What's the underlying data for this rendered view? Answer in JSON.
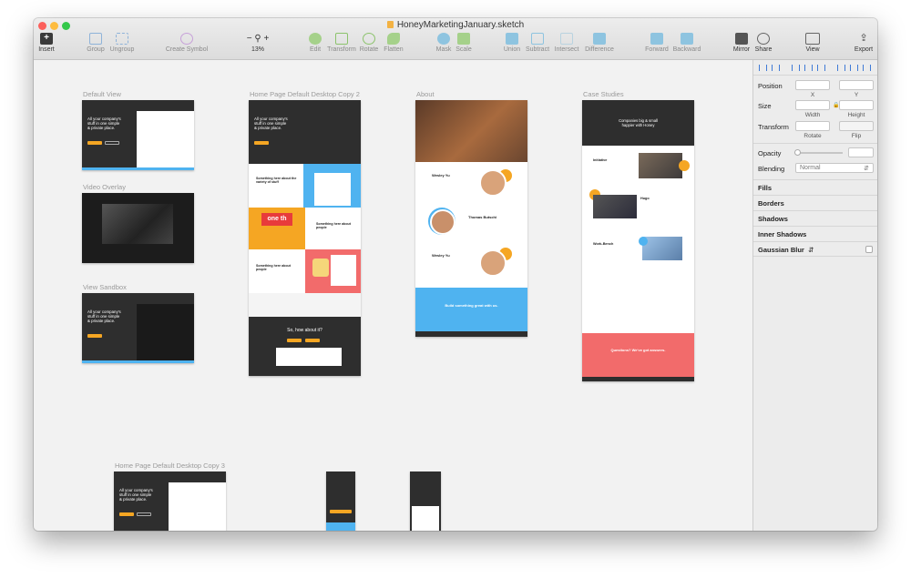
{
  "window": {
    "title": "HoneyMarketingJanuary.sketch"
  },
  "toolbar": {
    "insert": "Insert",
    "group": "Group",
    "ungroup": "Ungroup",
    "create_symbol": "Create Symbol",
    "zoom": "13%",
    "zoom_minus": "−",
    "zoom_plus": "+",
    "edit": "Edit",
    "transform": "Transform",
    "rotate": "Rotate",
    "flatten": "Flatten",
    "mask": "Mask",
    "scale": "Scale",
    "union": "Union",
    "subtract": "Subtract",
    "intersect": "Intersect",
    "difference": "Difference",
    "forward": "Forward",
    "backward": "Backward",
    "mirror": "Mirror",
    "share": "Share",
    "view": "View",
    "export": "Export"
  },
  "artboards": {
    "default_view": "Default View",
    "video_overlay": "Video Overlay",
    "view_sandbox": "View Sandbox",
    "home_copy2": "Home Page Default Desktop Copy 2",
    "about": "About",
    "case_studies": "Case Studies",
    "home_copy3": "Home Page Default Desktop Copy 3"
  },
  "artboard_content": {
    "hero_line1": "All your company's",
    "hero_line2": "stuff in one simple",
    "hero_line3": "& private place.",
    "about_person1": "Wesley Yu",
    "about_person2": "Thomas Butschi",
    "about_person3": "Wesley Yu",
    "about_cta": "Build something great with us.",
    "cs_hero1": "Companies big & small",
    "cs_hero2": "happier with Honey",
    "cs_section1": "Initiative",
    "cs_section2": "Hugo",
    "cs_section3": "Work-Bench",
    "cs_cta": "Questions? We've got answers.",
    "home2_cta": "So, how about it?",
    "home2_text1": "Something here about the variety of stuff",
    "home2_text2": "Something here about people",
    "home2_text3": "Something here about people",
    "home2_banner": "one th"
  },
  "inspector": {
    "position": "Position",
    "x": "X",
    "y": "Y",
    "size": "Size",
    "width": "Width",
    "height": "Height",
    "transform": "Transform",
    "rotate": "Rotate",
    "flip": "Flip",
    "opacity": "Opacity",
    "blending": "Blending",
    "blending_value": "Normal",
    "fills": "Fills",
    "borders": "Borders",
    "shadows": "Shadows",
    "inner_shadows": "Inner Shadows",
    "gaussian_blur": "Gaussian Blur"
  },
  "colors": {
    "honey_yellow": "#f5a623",
    "sky_blue": "#4fb3f0",
    "coral": "#f26b6b",
    "dark": "#2e2e2e"
  }
}
